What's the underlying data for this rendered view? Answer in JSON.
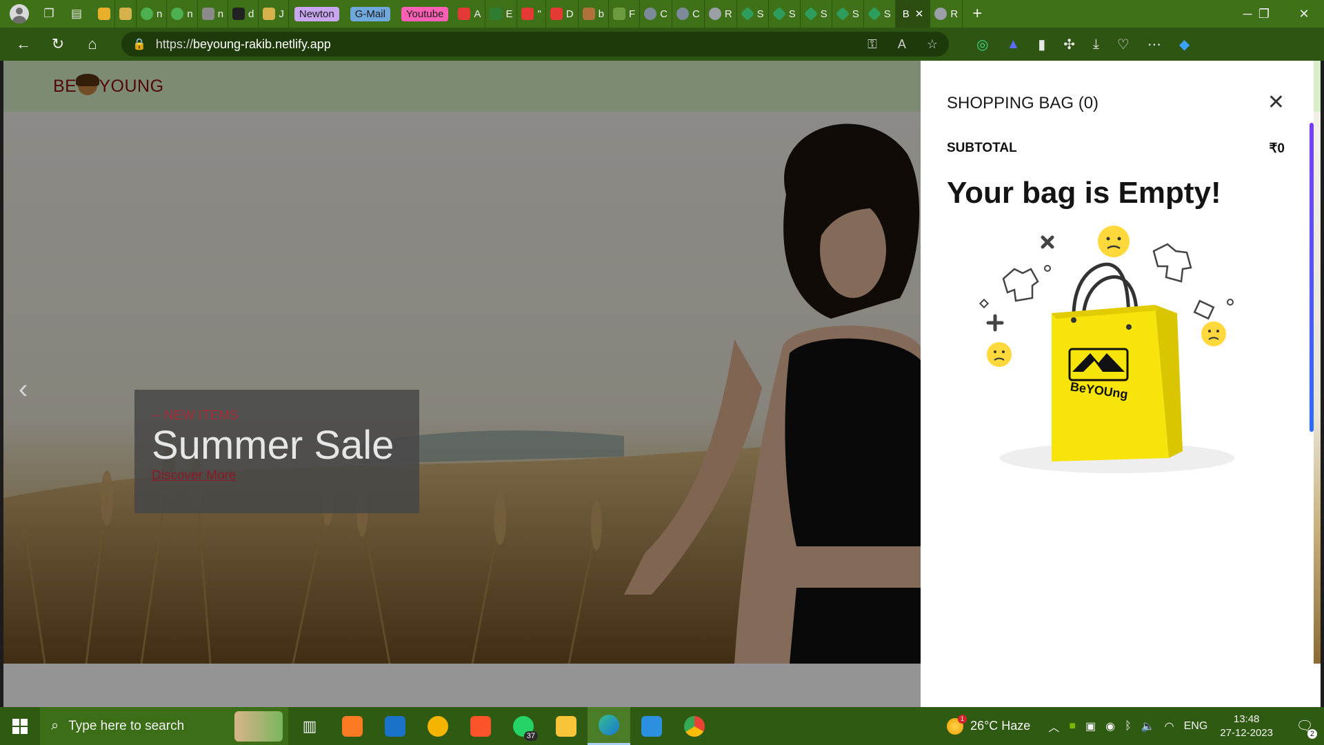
{
  "browser": {
    "tab_labels": [
      "n",
      "n",
      "n",
      "d",
      "J",
      "A",
      "E",
      "\"",
      "D",
      "b",
      "F",
      "C",
      "C",
      "R",
      "S",
      "S",
      "S",
      "S",
      "S",
      "R"
    ],
    "pills": [
      {
        "label": "Newton",
        "color": "#c9a6f2"
      },
      {
        "label": "G-Mail",
        "color": "#6fa8dc"
      },
      {
        "label": "Youtube",
        "color": "#ff5fb4"
      }
    ],
    "active_tab": "B",
    "url_scheme": "https://",
    "url_host": "beyoung-rakib.netlify.app"
  },
  "site": {
    "logo_left": "BE",
    "logo_right": "YOUNG",
    "promo": {
      "eyebrow": "-- NEW ITEMS",
      "headline": "Summer Sale",
      "cta": "Discover More"
    }
  },
  "cart": {
    "title": "SHOPPING BAG (0)",
    "subtotal_label": "SUBTOTAL",
    "subtotal_value": "₹0",
    "empty_message": "Your bag is Empty!",
    "bag_brand": "BeYOUng"
  },
  "taskbar": {
    "search_placeholder": "Type here to search",
    "whatsapp_badge": "37",
    "weather_alert": "1",
    "weather": "26°C  Haze",
    "language": "ENG",
    "time": "13:48",
    "date": "27-12-2023",
    "notifications": "2"
  },
  "colors": {
    "tab_strip": "#3f7118",
    "site_header": "#d9efc9",
    "brand_red": "#8b0a1a",
    "bag_yellow": "#f7e40b"
  }
}
